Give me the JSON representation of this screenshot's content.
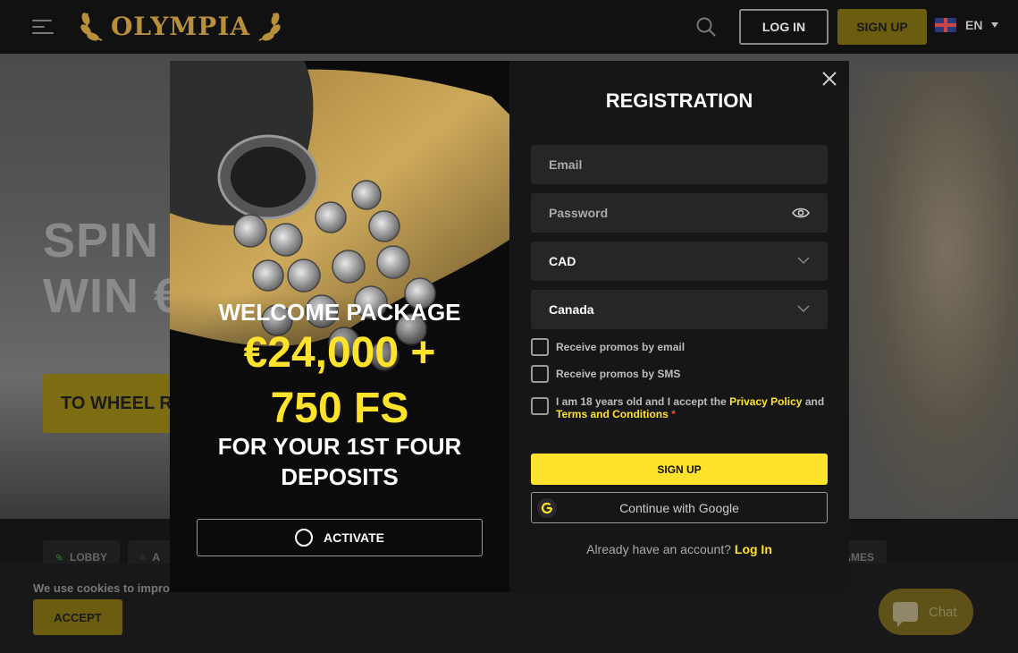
{
  "header": {
    "logo_text": "OLYMPIA",
    "login_label": "LOG IN",
    "signup_label": "SIGN UP",
    "language": "EN"
  },
  "hero": {
    "title_line1": "SPIN",
    "title_line2": "WIN €",
    "button_label": "TO WHEEL R"
  },
  "categories": [
    {
      "label": "LOBBY"
    },
    {
      "label": "A"
    },
    {
      "label": "AMES"
    }
  ],
  "cookie": {
    "text": "We use cookies to impro",
    "accept_label": "ACCEPT"
  },
  "chat": {
    "label": "Chat"
  },
  "modal": {
    "promo": {
      "title": "WELCOME PACKAGE",
      "amount_line1": "€24,000 +",
      "amount_line2": "750 FS",
      "sub_line1": "FOR YOUR 1ST FOUR",
      "sub_line2": "DEPOSITS",
      "activate_label": "ACTIVATE"
    },
    "registration": {
      "title": "REGISTRATION",
      "email_placeholder": "Email",
      "password_placeholder": "Password",
      "currency_value": "CAD",
      "country_value": "Canada",
      "promo_email_label": "Receive promos by email",
      "promo_sms_label": "Receive promos by SMS",
      "terms_prefix": "I am 18 years old and I accept the ",
      "privacy_link": "Privacy Policy",
      "terms_and": " and",
      "terms_link": "Terms and Conditions",
      "required_mark": " *",
      "signup_label": "SIGN UP",
      "google_label": "Continue with Google",
      "have_account_text": "Already have an account? ",
      "login_link": "Log In"
    }
  },
  "colors": {
    "accent_yellow": "#ffe22b",
    "brand_gold": "#b8903a",
    "modal_bg": "#161616"
  }
}
